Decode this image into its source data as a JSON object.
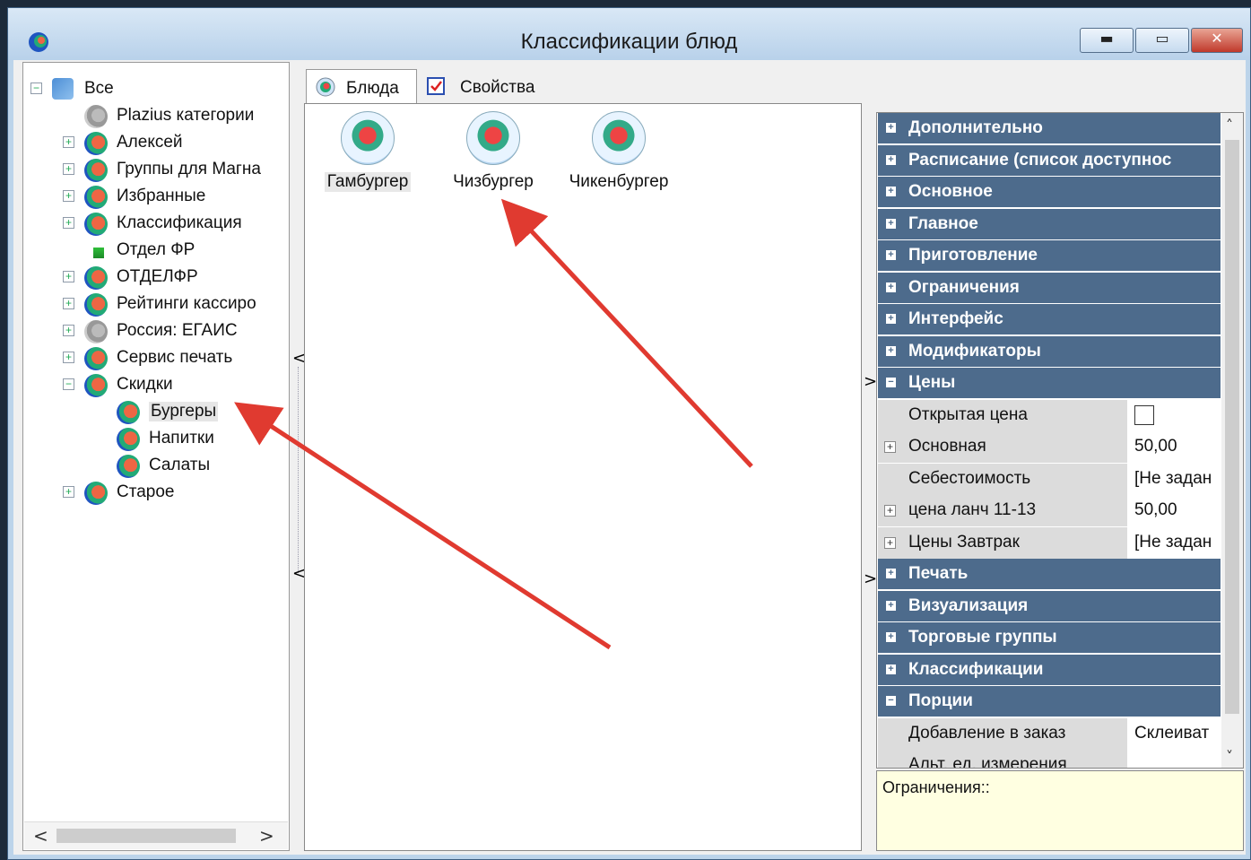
{
  "window": {
    "title": "Классификации блюд",
    "min_label": "▬",
    "max_label": "▭",
    "close_label": "✕"
  },
  "tree": {
    "root": "Все",
    "items": [
      {
        "label": "Plazius категории",
        "icon": "gray",
        "expander": ""
      },
      {
        "label": "Алексей",
        "icon": "color",
        "expander": "+"
      },
      {
        "label": "Группы для Магна",
        "icon": "color",
        "expander": "+"
      },
      {
        "label": "Избранные",
        "icon": "color",
        "expander": "+"
      },
      {
        "label": "Классификация",
        "icon": "color",
        "expander": "+"
      },
      {
        "label": "Отдел ФР",
        "icon": "doc",
        "expander": ""
      },
      {
        "label": "ОТДЕЛФР",
        "icon": "color",
        "expander": "+"
      },
      {
        "label": "Рейтинги кассиро",
        "icon": "color",
        "expander": "+"
      },
      {
        "label": "Россия: ЕГАИС",
        "icon": "gray",
        "expander": "+"
      },
      {
        "label": "Сервис печать",
        "icon": "color",
        "expander": "+"
      },
      {
        "label": "Скидки",
        "icon": "color",
        "expander": "−"
      },
      {
        "label": "Бургеры",
        "icon": "color",
        "expander": "",
        "child": true,
        "selected": true
      },
      {
        "label": "Напитки",
        "icon": "color",
        "expander": "",
        "child": true
      },
      {
        "label": "Салаты",
        "icon": "color",
        "expander": "",
        "child": true
      },
      {
        "label": "Старое",
        "icon": "color",
        "expander": "+"
      }
    ],
    "scroll_left": "<",
    "scroll_right": ">"
  },
  "tabs": [
    {
      "label": "Блюда",
      "icon": "dish-icon"
    },
    {
      "label": "Свойства",
      "icon": "properties-icon"
    }
  ],
  "items": [
    {
      "label": "Гамбургер",
      "selected": true
    },
    {
      "label": "Чизбургер"
    },
    {
      "label": "Чикенбургер"
    }
  ],
  "props": {
    "rows": [
      {
        "type": "cat",
        "label": "Дополнительно",
        "box": "+"
      },
      {
        "type": "cat",
        "label": "Расписание (список доступнос",
        "box": "+"
      },
      {
        "type": "cat",
        "label": "Основное",
        "box": "+"
      },
      {
        "type": "cat",
        "label": "Главное",
        "box": "+"
      },
      {
        "type": "cat",
        "label": "Приготовление",
        "box": "+"
      },
      {
        "type": "cat",
        "label": "Ограничения",
        "box": "+"
      },
      {
        "type": "cat",
        "label": "Интерфейс",
        "box": "+"
      },
      {
        "type": "cat",
        "label": "Модификаторы",
        "box": "+"
      },
      {
        "type": "cat",
        "label": "Цены",
        "box": "−"
      },
      {
        "type": "prop",
        "label": "Открытая цена",
        "value": "",
        "checkbox": true
      },
      {
        "type": "prop",
        "label": "Основная",
        "value": "50,00",
        "expander": "+"
      },
      {
        "type": "prop",
        "label": "Себестоимость",
        "value": "[Не задан"
      },
      {
        "type": "prop",
        "label": "цена ланч 11-13",
        "value": "50,00",
        "expander": "+"
      },
      {
        "type": "prop",
        "label": "Цены Завтрак",
        "value": "[Не задан",
        "expander": "+"
      },
      {
        "type": "cat",
        "label": "Печать",
        "box": "+"
      },
      {
        "type": "cat",
        "label": "Визуализация",
        "box": "+"
      },
      {
        "type": "cat",
        "label": "Торговые группы",
        "box": "+"
      },
      {
        "type": "cat",
        "label": "Классификации",
        "box": "+"
      },
      {
        "type": "cat",
        "label": "Порции",
        "box": "−"
      },
      {
        "type": "prop",
        "label": "Добавление в заказ",
        "value": "Склеиват"
      },
      {
        "type": "prop",
        "label": "Альт. ед. измерения",
        "value": ""
      }
    ],
    "scroll_up": "˄",
    "scroll_down": "˅"
  },
  "description": {
    "text": "Ограничения::"
  },
  "splitter": {
    "left": "<",
    "right": ">"
  },
  "annotation": {
    "arrow_color": "#e03a30"
  }
}
